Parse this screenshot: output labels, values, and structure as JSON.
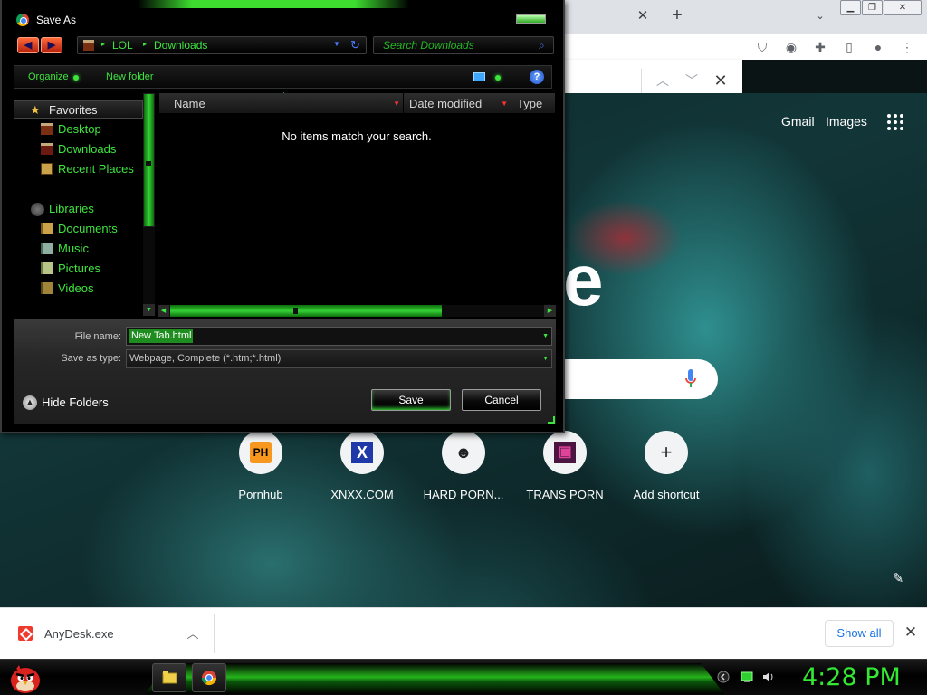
{
  "dialog": {
    "title": "Save As",
    "address": {
      "crumbs": [
        "LOL",
        "Downloads"
      ]
    },
    "search_placeholder": "Search Downloads",
    "commands": {
      "organize": "Organize",
      "new_folder": "New folder",
      "help": "?"
    },
    "nav": {
      "favorites_header": "Favorites",
      "favorites": [
        "Desktop",
        "Downloads",
        "Recent Places"
      ],
      "libraries_header": "Libraries",
      "libraries": [
        "Documents",
        "Music",
        "Pictures",
        "Videos"
      ]
    },
    "columns": [
      "Name",
      "Date modified",
      "Type"
    ],
    "empty_message": "No items match your search.",
    "file_name_label": "File name:",
    "file_name_value": "New Tab.html",
    "save_type_label": "Save as type:",
    "save_type_value": "Webpage, Complete (*.htm;*.html)",
    "hide_folders_label": "Hide Folders",
    "save_label": "Save",
    "cancel_label": "Cancel"
  },
  "new_tab_page": {
    "links": [
      "Gmail",
      "Images"
    ],
    "logo_fragment": "e",
    "shortcuts": [
      {
        "label": "Pornhub",
        "glyph": "PH"
      },
      {
        "label": "XNXX.COM",
        "glyph": "X"
      },
      {
        "label": "HARD PORN...",
        "glyph": "☻"
      },
      {
        "label": "TRANS PORN",
        "glyph": "▣"
      },
      {
        "label": "Add shortcut",
        "glyph": "+"
      }
    ]
  },
  "download_bar": {
    "file_name": "AnyDesk.exe",
    "show_all_label": "Show all"
  },
  "taskbar": {
    "clock": "4:28 PM"
  },
  "colors": {
    "dialog_accent": "#3ee53e",
    "chrome_link": "#1a73e8",
    "download_icon": "#ef3b2d",
    "clock": "#33e833"
  }
}
